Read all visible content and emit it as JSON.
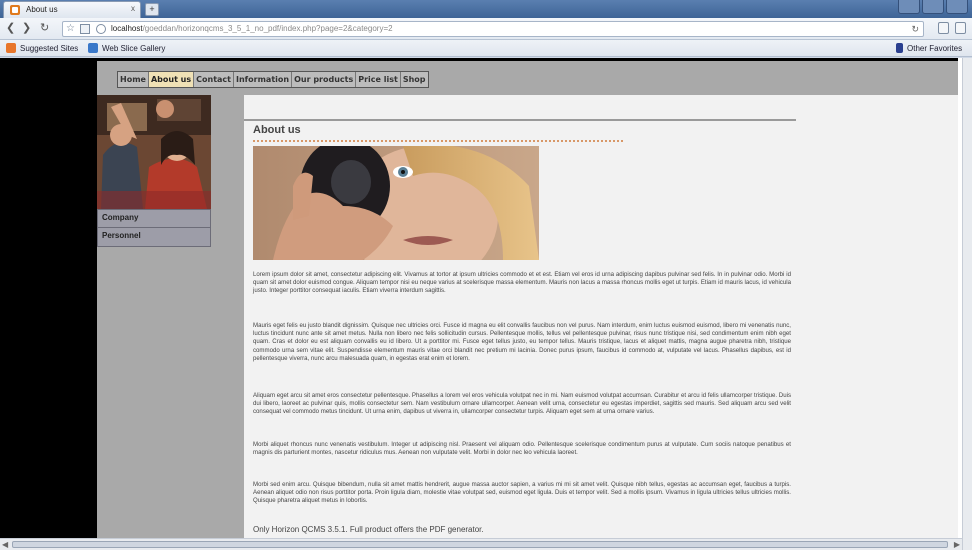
{
  "browser": {
    "tab_title": "About us",
    "tab_close": "x",
    "new_tab": "+",
    "url_host": "localhost",
    "url_path": "/goeddan/horizonqcms_3_5_1_no_pdf/index.php?page=2&category=2",
    "favorites": [
      "Suggested Sites",
      "Web Slice Gallery"
    ],
    "other_favorites": "Other Favorites"
  },
  "nav": {
    "items": [
      "Home",
      "About us",
      "Contact",
      "Information",
      "Our products",
      "Price list",
      "Shop"
    ],
    "active": "About us"
  },
  "sidebar": {
    "items": [
      "Company",
      "Personnel"
    ]
  },
  "content": {
    "heading": "About us",
    "paragraphs": [
      "Lorem ipsum dolor sit amet, consectetur adipiscing elit. Vivamus at tortor at ipsum ultricies commodo et et est. Etiam vel eros id urna adipiscing dapibus pulvinar sed felis. In in pulvinar odio. Morbi id quam sit amet dolor euismod congue. Aliquam tempor nisi eu neque varius at scelerisque massa elementum. Mauris non lacus a massa rhoncus mollis eget ut turpis. Etiam id mauris lacus, id vehicula justo. Integer porttitor consequat iaculis. Etiam viverra interdum sagittis.",
      "Mauris eget felis eu justo blandit dignissim. Quisque nec ultricies orci. Fusce id magna eu elit convallis faucibus non vel purus. Nam interdum, enim luctus euismod euismod, libero mi venenatis nunc, luctus tincidunt nunc ante sit amet metus. Nulla non libero nec felis sollicitudin cursus. Pellentesque mollis, tellus vel pellentesque pulvinar, risus nunc tristique nisi, sed condimentum enim nibh eget quam. Cras et dolor eu est aliquam convallis eu id libero. Ut a porttitor mi. Fusce eget tellus justo, eu tempor tellus. Mauris tristique, lacus et aliquet mattis, magna augue pharetra nibh, tristique commodo urna sem vitae elit. Suspendisse elementum mauris vitae orci blandit nec pretium mi lacinia. Donec purus ipsum, faucibus id commodo at, vulputate vel lacus. Phasellus dapibus, est id pellentesque viverra, nunc arcu malesuada quam, in egestas erat enim et lorem.",
      "Aliquam eget arcu sit amet eros consectetur pellentesque. Phasellus a lorem vel eros vehicula volutpat nec in mi. Nam euismod volutpat accumsan. Curabitur et arcu id felis ullamcorper tristique. Duis dui libero, laoreet ac pulvinar quis, mollis consectetur sem. Nam vestibulum ornare ullamcorper. Aenean velit urna, consectetur eu egestas imperdiet, sagittis sed mauris. Sed aliquam arcu sed velit consequat vel commodo metus tincidunt. Ut urna enim, dapibus ut viverra in, ullamcorper consectetur turpis. Aliquam eget sem at urna ornare varius.",
      "Morbi aliquet rhoncus nunc venenatis vestibulum. Integer ut adipiscing nisl. Praesent vel aliquam odio. Pellentesque scelerisque condimentum purus at vulputate. Cum sociis natoque penatibus et magnis dis parturient montes, nascetur ridiculus mus. Aenean non vulputate velit. Morbi in dolor nec leo vehicula laoreet.",
      "Morbi sed enim arcu. Quisque bibendum, nulla sit amet mattis hendrerit, augue massa auctor sapien, a varius mi mi sit amet velit. Quisque nibh tellus, egestas ac accumsan eget, faucibus a turpis. Aenean aliquet odio non risus porttitor porta. Proin ligula diam, molestie vitae volutpat sed, euismod eget ligula. Duis et tempor velit. Sed a mollis ipsum. Vivamus in ligula ultricies tellus ultricies mollis. Quisque pharetra aliquet metus in lobortis."
    ],
    "footer": "Only Horizon QCMS 3.5.1. Full product offers the PDF generator."
  },
  "colors": {
    "nav_bg": "#a9a9a9",
    "active_tab_bg": "#f0e1b5",
    "heading_underline": "#d89868"
  }
}
